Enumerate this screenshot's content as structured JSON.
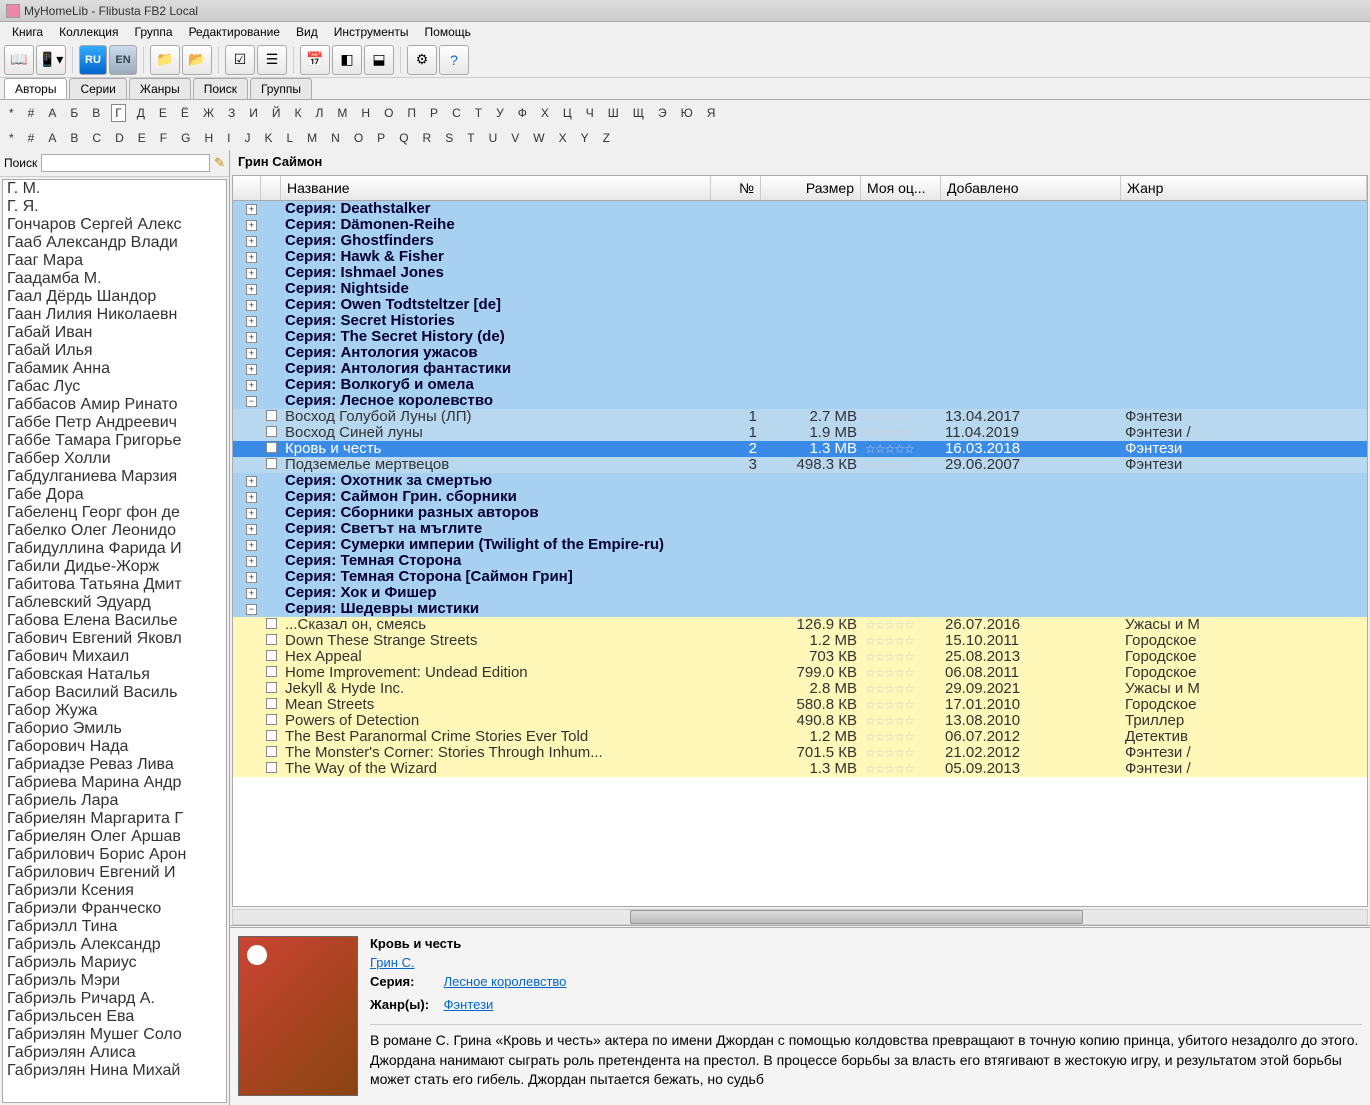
{
  "window": {
    "title": "MyHomeLib - Flibusta FB2 Local"
  },
  "menu": [
    "Книга",
    "Коллекция",
    "Группа",
    "Редактирование",
    "Вид",
    "Инструменты",
    "Помощь"
  ],
  "tabs": [
    {
      "label": "Авторы",
      "active": true
    },
    {
      "label": "Серии",
      "active": false
    },
    {
      "label": "Жанры",
      "active": false
    },
    {
      "label": "Поиск",
      "active": false
    },
    {
      "label": "Группы",
      "active": false
    }
  ],
  "alpha_ru": [
    "*",
    "#",
    "А",
    "Б",
    "В",
    "Г",
    "Д",
    "Е",
    "Ё",
    "Ж",
    "З",
    "И",
    "Й",
    "К",
    "Л",
    "М",
    "Н",
    "О",
    "П",
    "Р",
    "С",
    "Т",
    "У",
    "Ф",
    "Х",
    "Ц",
    "Ч",
    "Ш",
    "Щ",
    "Э",
    "Ю",
    "Я"
  ],
  "alpha_ru_sel": "Г",
  "alpha_en": [
    "*",
    "#",
    "A",
    "B",
    "C",
    "D",
    "E",
    "F",
    "G",
    "H",
    "I",
    "J",
    "K",
    "L",
    "M",
    "N",
    "O",
    "P",
    "Q",
    "R",
    "S",
    "T",
    "U",
    "V",
    "W",
    "X",
    "Y",
    "Z"
  ],
  "search_label": "Поиск",
  "authors": [
    "Г. М.",
    "Г. Я.",
    "Гончаров Сергей Алекс",
    "Гааб Александр Влади",
    "Гааг Мара",
    "Гаадамба М.",
    "Гаал Дёрдь Шандор",
    "Гаан Лилия Николаевн",
    "Габай Иван",
    "Габай Илья",
    "Габамик Анна",
    "Габас Лус",
    "Габбасов Амир Ринато",
    "Габбе Петр Андреевич",
    "Габбе Тамара Григорье",
    "Габбер Холли",
    "Габдулганиева Марзия",
    "Габе Дора",
    "Габеленц Георг фон де",
    "Габелко Олег Леонидо",
    "Габидуллина Фарида И",
    "Габили Дидье-Жорж",
    "Габитова Татьяна Дмит",
    "Габлевский Эдуард",
    "Габова Елена Василье",
    "Габович Евгений Яковл",
    "Габович Михаил",
    "Габовская Наталья",
    "Габор Василий Василь",
    "Габор Жужа",
    "Габорио Эмиль",
    "Габорович Нада",
    "Габриадзе Реваз Лива",
    "Габриева Марина Андр",
    "Габриель Лара",
    "Габриелян Маргарита Г",
    "Габриелян Олег Аршав",
    "Габрилович Борис Арон",
    "Габрилович Евгений И",
    "Габриэли Ксения",
    "Габриэли Франческо",
    "Габриэлл Тина",
    "Габриэль Александр",
    "Габриэль Мариус",
    "Габриэль Мэри",
    "Габриэль Ричард А.",
    "Габриэльсен Ева",
    "Габриэлян Мушег Соло",
    "Габриэлян Алиса",
    "Габриэлян Нина Михай"
  ],
  "current_author": "Грин Саймон",
  "columns": {
    "title": "Название",
    "num": "№",
    "size": "Размер",
    "rate": "Моя оц...",
    "date": "Добавлено",
    "genre": "Жанр"
  },
  "rows": [
    {
      "type": "s",
      "exp": "+",
      "title": "Серия: Deathstalker"
    },
    {
      "type": "s",
      "exp": "+",
      "title": "Серия: Dämonen-Reihe"
    },
    {
      "type": "s",
      "exp": "+",
      "title": "Серия: Ghostfinders"
    },
    {
      "type": "s",
      "exp": "+",
      "title": "Серия: Hawk & Fisher"
    },
    {
      "type": "s",
      "exp": "+",
      "title": "Серия: Ishmael Jones"
    },
    {
      "type": "s",
      "exp": "+",
      "title": "Серия: Nightside"
    },
    {
      "type": "s",
      "exp": "+",
      "title": "Серия: Owen Todtsteltzer [de]"
    },
    {
      "type": "s",
      "exp": "+",
      "title": "Серия: Secret Histories"
    },
    {
      "type": "s",
      "exp": "+",
      "title": "Серия: The Secret History (de)"
    },
    {
      "type": "s",
      "exp": "+",
      "title": "Серия: Антология ужасов"
    },
    {
      "type": "s",
      "exp": "+",
      "title": "Серия: Антология фантастики"
    },
    {
      "type": "s",
      "exp": "+",
      "title": "Серия: Волкогуб и омела"
    },
    {
      "type": "s",
      "exp": "−",
      "title": "Серия: Лесное королевство"
    },
    {
      "type": "ib",
      "title": "Восход Голубой Луны (ЛП)",
      "num": "1",
      "size": "2.7 MB",
      "date": "13.04.2017",
      "genre": "Фэнтези"
    },
    {
      "type": "ib",
      "title": "Восход Синей луны",
      "num": "1",
      "size": "1.9 MB",
      "date": "11.04.2019",
      "genre": "Фэнтези /"
    },
    {
      "type": "sel",
      "title": "Кровь и честь",
      "num": "2",
      "size": "1.3 MB",
      "date": "16.03.2018",
      "genre": "Фэнтези"
    },
    {
      "type": "ib",
      "title": "Подземелье мертвецов",
      "num": "3",
      "size": "498.3 КВ",
      "date": "29.06.2007",
      "genre": "Фэнтези"
    },
    {
      "type": "s",
      "exp": "+",
      "title": "Серия: Охотник за смертью"
    },
    {
      "type": "s",
      "exp": "+",
      "title": "Серия: Саймон Грин. сборники"
    },
    {
      "type": "s",
      "exp": "+",
      "title": "Серия: Сборники разных авторов"
    },
    {
      "type": "s",
      "exp": "+",
      "title": "Серия: Светът на мъглите"
    },
    {
      "type": "s",
      "exp": "+",
      "title": "Серия: Сумерки империи (Twilight of the Empire-ru)"
    },
    {
      "type": "s",
      "exp": "+",
      "title": "Серия: Темная Сторона"
    },
    {
      "type": "s",
      "exp": "+",
      "title": "Серия: Темная Сторона [Саймон Грин]"
    },
    {
      "type": "s",
      "exp": "+",
      "title": "Серия: Хок и Фишер"
    },
    {
      "type": "s",
      "exp": "−",
      "title": "Серия: Шедевры мистики"
    },
    {
      "type": "iy",
      "title": "...Сказал он, смеясь",
      "size": "126.9 КВ",
      "date": "26.07.2016",
      "genre": "Ужасы и М"
    },
    {
      "type": "iy",
      "title": "Down These Strange Streets",
      "size": "1.2 MB",
      "date": "15.10.2011",
      "genre": "Городское"
    },
    {
      "type": "iy",
      "title": "Hex Appeal",
      "size": "703 КВ",
      "date": "25.08.2013",
      "genre": "Городское"
    },
    {
      "type": "iy",
      "title": "Home Improvement: Undead Edition",
      "size": "799.0 КВ",
      "date": "06.08.2011",
      "genre": "Городское"
    },
    {
      "type": "iy",
      "title": "Jekyll & Hyde Inc.",
      "size": "2.8 MB",
      "date": "29.09.2021",
      "genre": "Ужасы и М"
    },
    {
      "type": "iy",
      "title": "Mean Streets",
      "size": "580.8 КВ",
      "date": "17.01.2010",
      "genre": "Городское"
    },
    {
      "type": "iy",
      "title": "Powers of Detection",
      "size": "490.8 КВ",
      "date": "13.08.2010",
      "genre": "Триллер"
    },
    {
      "type": "iy",
      "title": "The Best Paranormal Crime Stories Ever Told",
      "size": "1.2 MB",
      "date": "06.07.2012",
      "genre": "Детектив"
    },
    {
      "type": "iy",
      "title": "The Monster's Corner: Stories Through Inhum...",
      "size": "701.5 КВ",
      "date": "21.02.2012",
      "genre": "Фэнтези /"
    },
    {
      "type": "iy",
      "title": "The Way of the Wizard",
      "size": "1.3 MB",
      "date": "05.09.2013",
      "genre": "Фэнтези /"
    }
  ],
  "detail": {
    "title": "Кровь и честь",
    "author": "Грин С.",
    "series_lbl": "Серия:",
    "series": "Лесное королевство",
    "genre_lbl": "Жанр(ы):",
    "genre": "Фэнтези",
    "desc": "В романе С. Грина «Кровь и честь» актера по имени Джордан с помощью колдовства превращают в точную копию принца, убитого незадолго до этого. Джордана нанимают сыграть роль претендента на престол. В процессе борьбы за власть его втягивают в жестокую игру, и результатом этой борьбы может стать его гибель. Джордан пытается бежать, но судьб"
  },
  "toolbar_lang": {
    "ru": "RU",
    "en": "EN"
  }
}
